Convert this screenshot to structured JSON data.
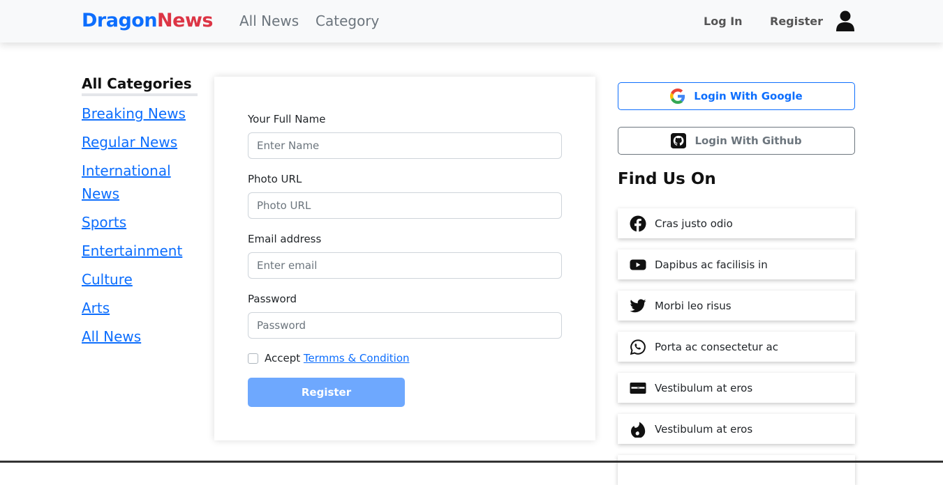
{
  "brand": {
    "part1": "Dragon",
    "part2": "News"
  },
  "nav": {
    "all_news": "All News",
    "category": "Category",
    "login": "Log In",
    "register": "Register"
  },
  "sidebar": {
    "title": "All Categories",
    "items": [
      {
        "label": "Breaking News"
      },
      {
        "label": "Regular News"
      },
      {
        "label": "International News"
      },
      {
        "label": "Sports"
      },
      {
        "label": "Entertainment"
      },
      {
        "label": "Culture"
      },
      {
        "label": "Arts"
      },
      {
        "label": "All News"
      }
    ]
  },
  "form": {
    "name_label": "Your Full Name",
    "name_placeholder": "Enter Name",
    "photo_label": "Photo URL",
    "photo_placeholder": "Photo URL",
    "email_label": "Email address",
    "email_placeholder": "Enter email",
    "password_label": "Password",
    "password_placeholder": "Password",
    "accept_text": "Accept",
    "terms_link": "Termms & Condition",
    "submit_label": "Register"
  },
  "right": {
    "google_label": "Login With Google",
    "github_label": "Login With Github",
    "find_title": "Find Us On",
    "social": [
      {
        "icon": "facebook-icon",
        "label": "Cras justo odio"
      },
      {
        "icon": "youtube-icon",
        "label": "Dapibus ac facilisis in"
      },
      {
        "icon": "twitter-icon",
        "label": "Morbi leo risus"
      },
      {
        "icon": "whatsapp-icon",
        "label": "Porta ac consectetur ac"
      },
      {
        "icon": "discover-icon",
        "label": "Vestibulum at eros"
      },
      {
        "icon": "tinder-icon",
        "label": "Vestibulum at eros"
      }
    ]
  },
  "colors": {
    "primary": "#0d6efd",
    "brand_red": "#dc3545",
    "button_light": "#6ea8fe"
  }
}
